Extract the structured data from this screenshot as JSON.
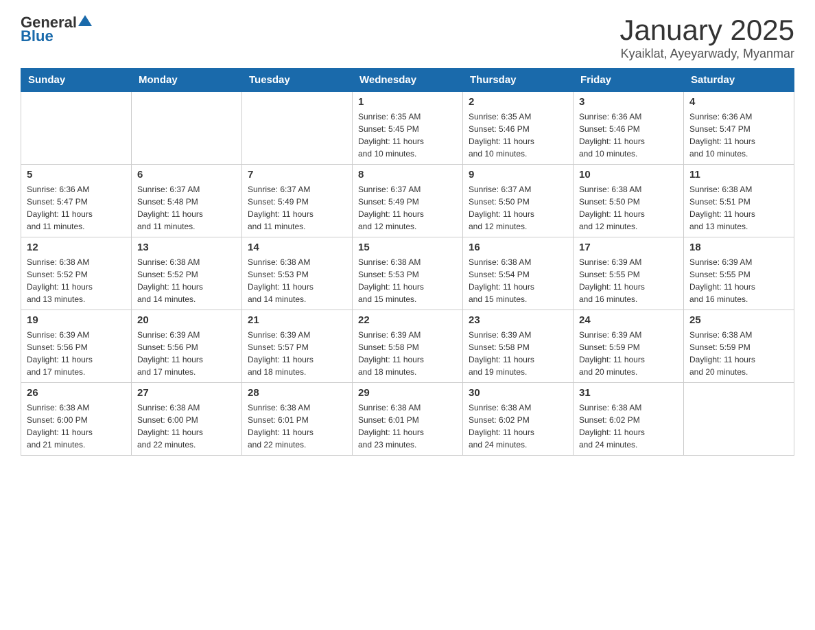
{
  "header": {
    "logo_general": "General",
    "logo_blue": "Blue",
    "title": "January 2025",
    "subtitle": "Kyaiklat, Ayeyarwady, Myanmar"
  },
  "days_of_week": [
    "Sunday",
    "Monday",
    "Tuesday",
    "Wednesday",
    "Thursday",
    "Friday",
    "Saturday"
  ],
  "weeks": [
    [
      {
        "day": "",
        "info": ""
      },
      {
        "day": "",
        "info": ""
      },
      {
        "day": "",
        "info": ""
      },
      {
        "day": "1",
        "info": "Sunrise: 6:35 AM\nSunset: 5:45 PM\nDaylight: 11 hours\nand 10 minutes."
      },
      {
        "day": "2",
        "info": "Sunrise: 6:35 AM\nSunset: 5:46 PM\nDaylight: 11 hours\nand 10 minutes."
      },
      {
        "day": "3",
        "info": "Sunrise: 6:36 AM\nSunset: 5:46 PM\nDaylight: 11 hours\nand 10 minutes."
      },
      {
        "day": "4",
        "info": "Sunrise: 6:36 AM\nSunset: 5:47 PM\nDaylight: 11 hours\nand 10 minutes."
      }
    ],
    [
      {
        "day": "5",
        "info": "Sunrise: 6:36 AM\nSunset: 5:47 PM\nDaylight: 11 hours\nand 11 minutes."
      },
      {
        "day": "6",
        "info": "Sunrise: 6:37 AM\nSunset: 5:48 PM\nDaylight: 11 hours\nand 11 minutes."
      },
      {
        "day": "7",
        "info": "Sunrise: 6:37 AM\nSunset: 5:49 PM\nDaylight: 11 hours\nand 11 minutes."
      },
      {
        "day": "8",
        "info": "Sunrise: 6:37 AM\nSunset: 5:49 PM\nDaylight: 11 hours\nand 12 minutes."
      },
      {
        "day": "9",
        "info": "Sunrise: 6:37 AM\nSunset: 5:50 PM\nDaylight: 11 hours\nand 12 minutes."
      },
      {
        "day": "10",
        "info": "Sunrise: 6:38 AM\nSunset: 5:50 PM\nDaylight: 11 hours\nand 12 minutes."
      },
      {
        "day": "11",
        "info": "Sunrise: 6:38 AM\nSunset: 5:51 PM\nDaylight: 11 hours\nand 13 minutes."
      }
    ],
    [
      {
        "day": "12",
        "info": "Sunrise: 6:38 AM\nSunset: 5:52 PM\nDaylight: 11 hours\nand 13 minutes."
      },
      {
        "day": "13",
        "info": "Sunrise: 6:38 AM\nSunset: 5:52 PM\nDaylight: 11 hours\nand 14 minutes."
      },
      {
        "day": "14",
        "info": "Sunrise: 6:38 AM\nSunset: 5:53 PM\nDaylight: 11 hours\nand 14 minutes."
      },
      {
        "day": "15",
        "info": "Sunrise: 6:38 AM\nSunset: 5:53 PM\nDaylight: 11 hours\nand 15 minutes."
      },
      {
        "day": "16",
        "info": "Sunrise: 6:38 AM\nSunset: 5:54 PM\nDaylight: 11 hours\nand 15 minutes."
      },
      {
        "day": "17",
        "info": "Sunrise: 6:39 AM\nSunset: 5:55 PM\nDaylight: 11 hours\nand 16 minutes."
      },
      {
        "day": "18",
        "info": "Sunrise: 6:39 AM\nSunset: 5:55 PM\nDaylight: 11 hours\nand 16 minutes."
      }
    ],
    [
      {
        "day": "19",
        "info": "Sunrise: 6:39 AM\nSunset: 5:56 PM\nDaylight: 11 hours\nand 17 minutes."
      },
      {
        "day": "20",
        "info": "Sunrise: 6:39 AM\nSunset: 5:56 PM\nDaylight: 11 hours\nand 17 minutes."
      },
      {
        "day": "21",
        "info": "Sunrise: 6:39 AM\nSunset: 5:57 PM\nDaylight: 11 hours\nand 18 minutes."
      },
      {
        "day": "22",
        "info": "Sunrise: 6:39 AM\nSunset: 5:58 PM\nDaylight: 11 hours\nand 18 minutes."
      },
      {
        "day": "23",
        "info": "Sunrise: 6:39 AM\nSunset: 5:58 PM\nDaylight: 11 hours\nand 19 minutes."
      },
      {
        "day": "24",
        "info": "Sunrise: 6:39 AM\nSunset: 5:59 PM\nDaylight: 11 hours\nand 20 minutes."
      },
      {
        "day": "25",
        "info": "Sunrise: 6:38 AM\nSunset: 5:59 PM\nDaylight: 11 hours\nand 20 minutes."
      }
    ],
    [
      {
        "day": "26",
        "info": "Sunrise: 6:38 AM\nSunset: 6:00 PM\nDaylight: 11 hours\nand 21 minutes."
      },
      {
        "day": "27",
        "info": "Sunrise: 6:38 AM\nSunset: 6:00 PM\nDaylight: 11 hours\nand 22 minutes."
      },
      {
        "day": "28",
        "info": "Sunrise: 6:38 AM\nSunset: 6:01 PM\nDaylight: 11 hours\nand 22 minutes."
      },
      {
        "day": "29",
        "info": "Sunrise: 6:38 AM\nSunset: 6:01 PM\nDaylight: 11 hours\nand 23 minutes."
      },
      {
        "day": "30",
        "info": "Sunrise: 6:38 AM\nSunset: 6:02 PM\nDaylight: 11 hours\nand 24 minutes."
      },
      {
        "day": "31",
        "info": "Sunrise: 6:38 AM\nSunset: 6:02 PM\nDaylight: 11 hours\nand 24 minutes."
      },
      {
        "day": "",
        "info": ""
      }
    ]
  ]
}
